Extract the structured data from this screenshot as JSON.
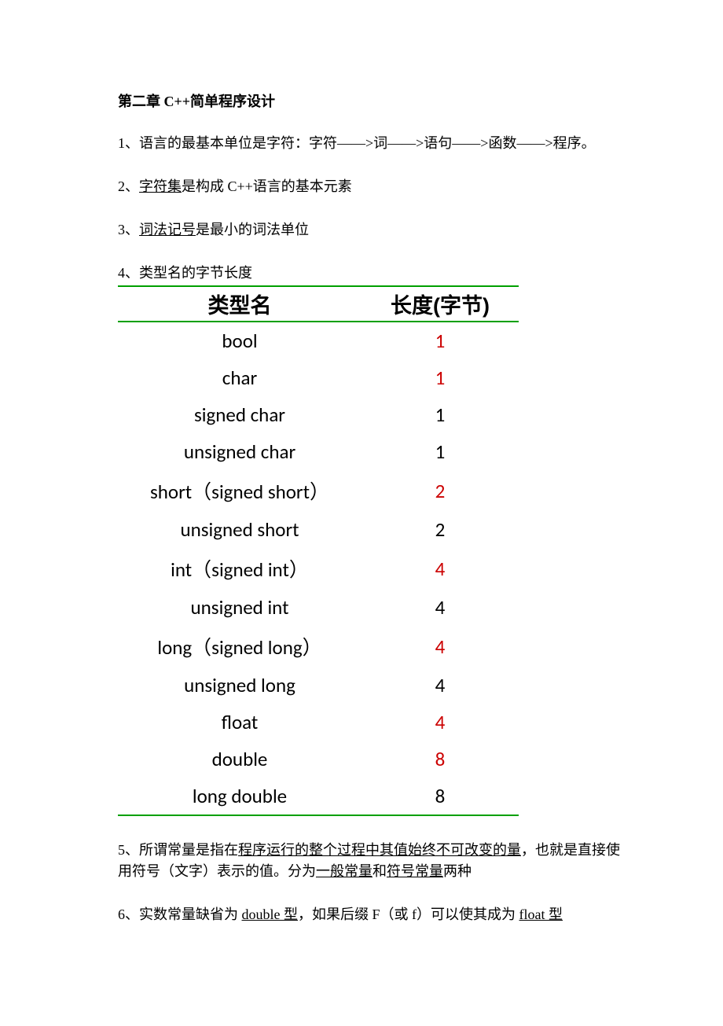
{
  "title": "第二章  C++简单程序设计",
  "items": {
    "i1": "1、语言的最基本单位是字符：字符——>词——>语句——>函数——>程序。",
    "i2a": "2、",
    "i2u": "字符集",
    "i2b": "是构成 C++语言的基本元素",
    "i3a": "3、",
    "i3u": "词法记号",
    "i3b": "是最小的词法单位",
    "i4": "4、类型名的字节长度",
    "i5a": "5、所谓常量是指在",
    "i5u1": "程序运行的整个过程中其值始终不可改变的量",
    "i5b": "，也就是直接使用符号（文字）表示的值。分为",
    "i5u2": "一般常量",
    "i5c": "和",
    "i5u3": "符号常量",
    "i5d": "两种",
    "i6a": "6、实数常量缺省为 ",
    "i6u1": "double 型",
    "i6b": "，如果后缀 F（或 f）可以使其成为 ",
    "i6u2": "float 型"
  },
  "table": {
    "headers": {
      "name": "类型名",
      "len": "长度(字节)"
    },
    "rows": [
      {
        "name": "bool",
        "len": "1",
        "red": true
      },
      {
        "name": "char",
        "len": "1",
        "red": true
      },
      {
        "name": "signed char",
        "len": "1",
        "red": false
      },
      {
        "name": "unsigned char",
        "len": "1",
        "red": false
      },
      {
        "name": "short（signed short）",
        "len": "2",
        "red": true
      },
      {
        "name": "unsigned short",
        "len": "2",
        "red": false
      },
      {
        "name": "int（signed int）",
        "len": "4",
        "red": true
      },
      {
        "name": "unsigned int",
        "len": "4",
        "red": false
      },
      {
        "name": "long（signed long）",
        "len": "4",
        "red": true
      },
      {
        "name": "unsigned long",
        "len": "4",
        "red": false
      },
      {
        "name": "float",
        "len": "4",
        "red": true
      },
      {
        "name": "double",
        "len": "8",
        "red": true
      },
      {
        "name": "long double",
        "len": "8",
        "red": false
      }
    ]
  }
}
